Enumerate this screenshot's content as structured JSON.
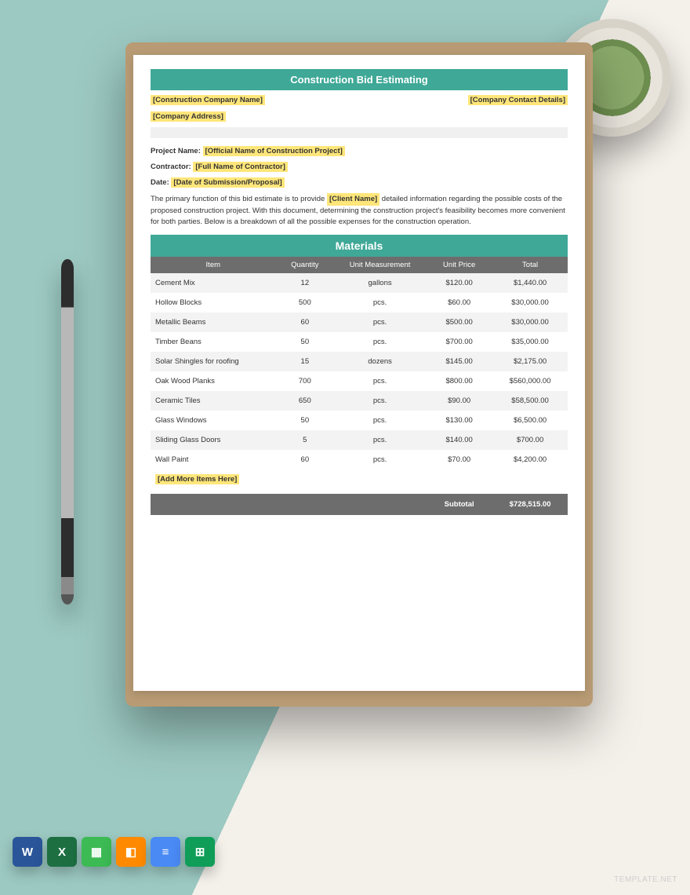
{
  "title": "Construction Bid Estimating",
  "placeholders": {
    "company_name": "[Construction Company Name]",
    "company_address": "[Company Address]",
    "contact_details": "[Company Contact Details]",
    "project_name": "[Official Name of Construction Project]",
    "contractor": "[Full Name of Contractor]",
    "date": "[Date of Submission/Proposal]",
    "client_name": "[Client Name]",
    "add_more": "[Add More Items Here]"
  },
  "labels": {
    "project_name": "Project Name:",
    "contractor": "Contractor:",
    "date": "Date:",
    "materials": "Materials",
    "subtotal": "Subtotal"
  },
  "description": {
    "pre": "The primary function of this bid estimate is to provide ",
    "post": " detailed information regarding the possible costs of the proposed construction project. With this document, determining the construction project's feasibility becomes more convenient for both parties. Below is a breakdown of all the possible expenses for the construction operation."
  },
  "columns": [
    "Item",
    "Quantity",
    "Unit Measurement",
    "Unit Price",
    "Total"
  ],
  "rows": [
    {
      "item": "Cement Mix",
      "qty": "12",
      "unit": "gallons",
      "price": "$120.00",
      "total": "$1,440.00"
    },
    {
      "item": "Hollow Blocks",
      "qty": "500",
      "unit": "pcs.",
      "price": "$60.00",
      "total": "$30,000.00"
    },
    {
      "item": "Metallic Beams",
      "qty": "60",
      "unit": "pcs.",
      "price": "$500.00",
      "total": "$30,000.00"
    },
    {
      "item": "Timber Beans",
      "qty": "50",
      "unit": "pcs.",
      "price": "$700.00",
      "total": "$35,000.00"
    },
    {
      "item": "Solar Shingles for roofing",
      "qty": "15",
      "unit": "dozens",
      "price": "$145.00",
      "total": "$2,175.00"
    },
    {
      "item": "Oak Wood Planks",
      "qty": "700",
      "unit": "pcs.",
      "price": "$800.00",
      "total": "$560,000.00"
    },
    {
      "item": "Ceramic Tiles",
      "qty": "650",
      "unit": "pcs.",
      "price": "$90.00",
      "total": "$58,500.00"
    },
    {
      "item": "Glass Windows",
      "qty": "50",
      "unit": "pcs.",
      "price": "$130.00",
      "total": "$6,500.00"
    },
    {
      "item": "Sliding Glass Doors",
      "qty": "5",
      "unit": "pcs.",
      "price": "$140.00",
      "total": "$700.00"
    },
    {
      "item": "Wall Paint",
      "qty": "60",
      "unit": "pcs.",
      "price": "$70.00",
      "total": "$4,200.00"
    }
  ],
  "subtotal_value": "$728,515.00",
  "badges": [
    "W",
    "X",
    "▦",
    "◧",
    "≡",
    "⊞"
  ],
  "watermark": "TEMPLATE.NET"
}
